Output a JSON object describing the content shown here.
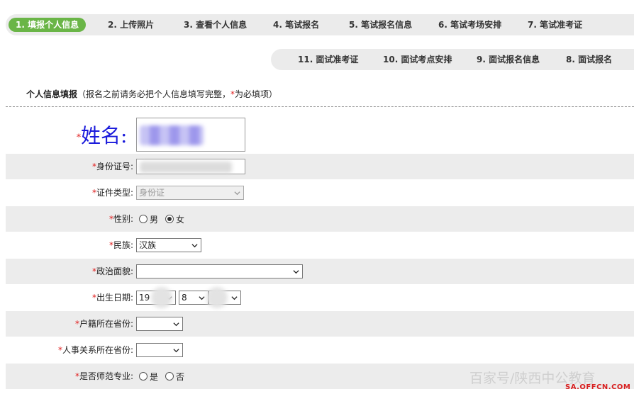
{
  "steps_top": [
    {
      "label": "1. 填报个人信息",
      "active": true
    },
    {
      "label": "2. 上传照片"
    },
    {
      "label": "3. 查看个人信息"
    },
    {
      "label": "4. 笔试报名"
    },
    {
      "label": "5. 笔试报名信息"
    },
    {
      "label": "6. 笔试考场安排"
    },
    {
      "label": "7. 笔试准考证"
    }
  ],
  "steps_bottom": [
    {
      "label": "11. 面试准考证"
    },
    {
      "label": "10. 面试考点安排"
    },
    {
      "label": "9. 面试报名信息"
    },
    {
      "label": "8. 面试报名"
    }
  ],
  "section": {
    "title": "个人信息填报",
    "note_prefix": "（报名之前请务必把个人信息填写完整，",
    "note_star": "*",
    "note_suffix": "为必填项）"
  },
  "required_mark": "*",
  "form": {
    "name_label": "姓名:",
    "id_label": "身份证号:",
    "cert_type_label": "证件类型:",
    "cert_type_value": "身份证",
    "gender_label": "性别:",
    "gender_male": "男",
    "gender_female": "女",
    "ethnicity_label": "民族:",
    "ethnicity_value": "汉族",
    "political_label": "政治面貌:",
    "political_value": "",
    "birth_label": "出生日期:",
    "birth_year_visible": "19",
    "birth_month": "8",
    "hukou_label": "户籍所在省份:",
    "hr_label": "人事关系所在省份:",
    "teacher_label": "是否师范专业:",
    "teacher_yes": "是",
    "teacher_no": "否"
  },
  "watermark": {
    "text": "百家号/陕西中公教育",
    "url": "SA.OFFCN.COM"
  },
  "colors": {
    "active_step": "#6ab547",
    "step_bar": "#ebebeb",
    "row_shade": "#ececec",
    "required": "#e02020",
    "name_label": "#1a1adb"
  }
}
